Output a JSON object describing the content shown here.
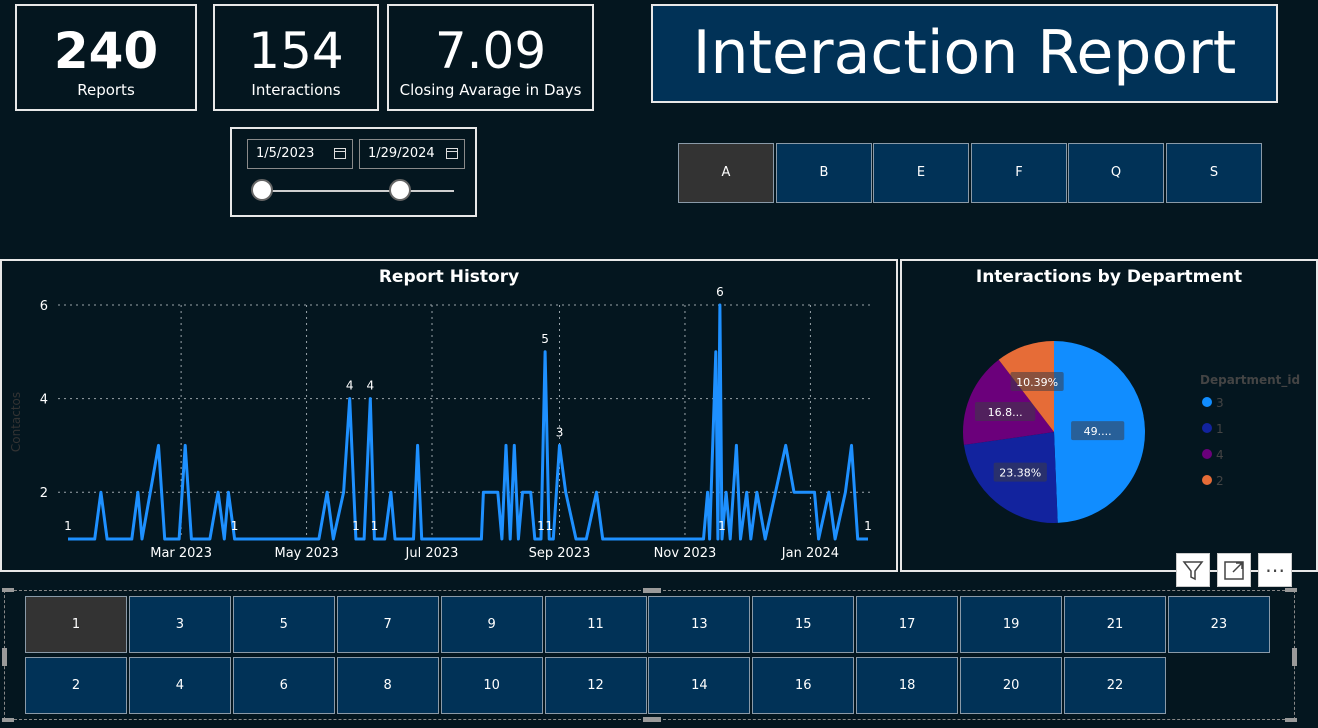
{
  "kpis": [
    {
      "value": "240",
      "label": "Reports"
    },
    {
      "value": "154",
      "label": "Interactions"
    },
    {
      "value": "7.09",
      "label": "Closing Avarage in Days"
    }
  ],
  "title": "Interaction Report",
  "date_range": {
    "start": "1/5/2023",
    "end": "1/29/2024",
    "icon": "calendar-icon"
  },
  "segment_buttons": [
    "A",
    "B",
    "E",
    "F",
    "Q",
    "S"
  ],
  "segment_selected": "A",
  "number_buttons_row1": [
    "1",
    "3",
    "5",
    "7",
    "9",
    "11",
    "13",
    "15",
    "17",
    "19",
    "21",
    "23"
  ],
  "number_buttons_row2": [
    "2",
    "4",
    "6",
    "8",
    "10",
    "12",
    "14",
    "16",
    "18",
    "20",
    "22"
  ],
  "number_selected": "1",
  "visual_actions": {
    "filter_icon": "filter-icon",
    "expand_icon": "expand-icon",
    "more_icon": "more-options-icon",
    "more_label": "⋯"
  },
  "colors": {
    "background": "#04161f",
    "tile": "#013257",
    "selected": "#333333",
    "line": "#1e90ff"
  },
  "chart_data": [
    {
      "type": "line",
      "title": "Report History",
      "ylabel": "Contactos",
      "ylim": [
        1,
        6
      ],
      "yticks": [
        2,
        4,
        6
      ],
      "xlim": [
        "2023-01-05",
        "2024-01-29"
      ],
      "xticks": [
        {
          "date": "2023-03-01",
          "label": "Mar 2023"
        },
        {
          "date": "2023-05-01",
          "label": "May 2023"
        },
        {
          "date": "2023-07-01",
          "label": "Jul 2023"
        },
        {
          "date": "2023-09-01",
          "label": "Sep 2023"
        },
        {
          "date": "2023-11-01",
          "label": "Nov 2023"
        },
        {
          "date": "2024-01-01",
          "label": "Jan 2024"
        }
      ],
      "grid": true,
      "series": [
        {
          "color": "#1e90ff",
          "points": [
            [
              "2023-01-05",
              1
            ],
            [
              "2023-01-18",
              1
            ],
            [
              "2023-01-21",
              2
            ],
            [
              "2023-01-24",
              1
            ],
            [
              "2023-02-05",
              1
            ],
            [
              "2023-02-08",
              2
            ],
            [
              "2023-02-10",
              1
            ],
            [
              "2023-02-14",
              2
            ],
            [
              "2023-02-18",
              3
            ],
            [
              "2023-02-21",
              1
            ],
            [
              "2023-02-28",
              1
            ],
            [
              "2023-03-03",
              3
            ],
            [
              "2023-03-06",
              1
            ],
            [
              "2023-03-15",
              1
            ],
            [
              "2023-03-19",
              2
            ],
            [
              "2023-03-22",
              1
            ],
            [
              "2023-03-24",
              2
            ],
            [
              "2023-03-27",
              1
            ],
            [
              "2023-05-07",
              1
            ],
            [
              "2023-05-11",
              2
            ],
            [
              "2023-05-14",
              1
            ],
            [
              "2023-05-19",
              2
            ],
            [
              "2023-05-22",
              4
            ],
            [
              "2023-05-25",
              1
            ],
            [
              "2023-05-29",
              1
            ],
            [
              "2023-06-01",
              4
            ],
            [
              "2023-06-03",
              1
            ],
            [
              "2023-06-08",
              1
            ],
            [
              "2023-06-11",
              2
            ],
            [
              "2023-06-13",
              1
            ],
            [
              "2023-06-22",
              1
            ],
            [
              "2023-06-24",
              3
            ],
            [
              "2023-06-26",
              1
            ],
            [
              "2023-07-25",
              1
            ],
            [
              "2023-07-26",
              2
            ],
            [
              "2023-08-02",
              2
            ],
            [
              "2023-08-04",
              1
            ],
            [
              "2023-08-06",
              3
            ],
            [
              "2023-08-08",
              1
            ],
            [
              "2023-08-10",
              3
            ],
            [
              "2023-08-12",
              1
            ],
            [
              "2023-08-14",
              2
            ],
            [
              "2023-08-18",
              2
            ],
            [
              "2023-08-20",
              1
            ],
            [
              "2023-08-23",
              1
            ],
            [
              "2023-08-25",
              5
            ],
            [
              "2023-08-27",
              1
            ],
            [
              "2023-08-29",
              1
            ],
            [
              "2023-09-01",
              3
            ],
            [
              "2023-09-04",
              2
            ],
            [
              "2023-09-09",
              1
            ],
            [
              "2023-09-14",
              1
            ],
            [
              "2023-09-19",
              2
            ],
            [
              "2023-09-22",
              1
            ],
            [
              "2023-11-10",
              1
            ],
            [
              "2023-11-12",
              2
            ],
            [
              "2023-11-13",
              1
            ],
            [
              "2023-11-16",
              5
            ],
            [
              "2023-11-17",
              1
            ],
            [
              "2023-11-18",
              6
            ],
            [
              "2023-11-19",
              1
            ],
            [
              "2023-11-21",
              2
            ],
            [
              "2023-11-23",
              1
            ],
            [
              "2023-11-26",
              3
            ],
            [
              "2023-11-28",
              1
            ],
            [
              "2023-12-01",
              2
            ],
            [
              "2023-12-03",
              1
            ],
            [
              "2023-12-06",
              2
            ],
            [
              "2023-12-10",
              1
            ],
            [
              "2023-12-15",
              2
            ],
            [
              "2023-12-20",
              3
            ],
            [
              "2023-12-24",
              2
            ],
            [
              "2024-01-03",
              2
            ],
            [
              "2024-01-05",
              1
            ],
            [
              "2024-01-10",
              2
            ],
            [
              "2024-01-13",
              1
            ],
            [
              "2024-01-18",
              2
            ],
            [
              "2024-01-21",
              3
            ],
            [
              "2024-01-24",
              1
            ],
            [
              "2024-01-29",
              1
            ]
          ]
        }
      ],
      "data_labels": [
        {
          "date": "2023-01-05",
          "value": 1,
          "text": "1"
        },
        {
          "date": "2023-03-27",
          "value": 1,
          "text": "1"
        },
        {
          "date": "2023-05-22",
          "value": 4,
          "text": "4"
        },
        {
          "date": "2023-05-25",
          "value": 1,
          "text": "1"
        },
        {
          "date": "2023-06-01",
          "value": 4,
          "text": "4"
        },
        {
          "date": "2023-06-03",
          "value": 1,
          "text": "1"
        },
        {
          "date": "2023-08-23",
          "value": 1,
          "text": "1"
        },
        {
          "date": "2023-08-25",
          "value": 5,
          "text": "5"
        },
        {
          "date": "2023-08-27",
          "value": 1,
          "text": "1"
        },
        {
          "date": "2023-09-01",
          "value": 3,
          "text": "3"
        },
        {
          "date": "2023-11-18",
          "value": 6,
          "text": "6"
        },
        {
          "date": "2023-11-19",
          "value": 1,
          "text": "1"
        },
        {
          "date": "2024-01-29",
          "value": 1,
          "text": "1"
        }
      ]
    },
    {
      "type": "pie",
      "title": "Interactions by Department",
      "legend_title": "Department_id",
      "legend_position": "right",
      "slices": [
        {
          "label": "3",
          "value": 49.35,
          "display": "49....",
          "color": "#118dff"
        },
        {
          "label": "1",
          "value": 23.38,
          "display": "23.38%",
          "color": "#12239e"
        },
        {
          "label": "4",
          "value": 16.88,
          "display": "16.8...",
          "color": "#6b007b"
        },
        {
          "label": "2",
          "value": 10.39,
          "display": "10.39%",
          "color": "#e66c37"
        }
      ]
    }
  ]
}
